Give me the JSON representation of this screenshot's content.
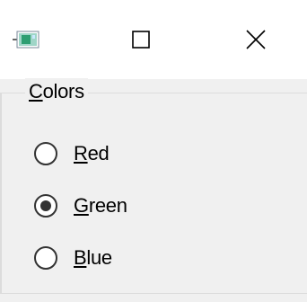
{
  "window": {
    "icon": "app-window-icon",
    "buttons": {
      "maximize": "maximize-icon",
      "close": "close-icon"
    }
  },
  "group": {
    "title_accel": "C",
    "title_rest": "olors"
  },
  "radios": [
    {
      "accel": "R",
      "rest": "ed",
      "checked": false
    },
    {
      "accel": "G",
      "rest": "reen",
      "checked": true
    },
    {
      "accel": "B",
      "rest": "lue",
      "checked": false
    }
  ],
  "colors": {
    "title_bg": "#ffffff",
    "body_bg": "#f0f0f0",
    "border": "#dcdcdc",
    "icon_green": "#2e9e72"
  }
}
